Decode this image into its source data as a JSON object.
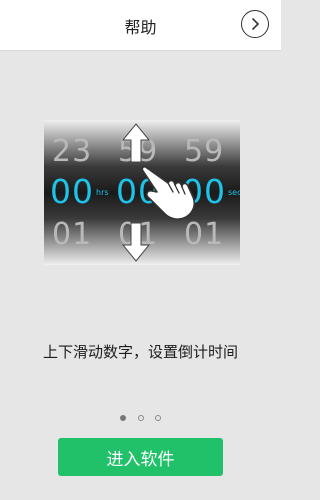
{
  "header": {
    "title": "帮助"
  },
  "picker": {
    "top_row": [
      "23",
      "59",
      "59"
    ],
    "active_row": [
      "00",
      "00",
      "00"
    ],
    "bottom_row": [
      "01",
      "01",
      "01"
    ],
    "units": [
      "hrs",
      "min",
      "sec"
    ]
  },
  "hint": "上下滑动数字，设置倒计时间",
  "pagination": {
    "count": 3,
    "current": 1
  },
  "enter_button": "进入软件",
  "colors": {
    "accent_cyan": "#1fc3e8",
    "button_green": "#21c16a"
  },
  "icons": [
    "chevron-right-icon",
    "arrow-up-icon",
    "arrow-down-icon",
    "hand-pointer-icon"
  ]
}
